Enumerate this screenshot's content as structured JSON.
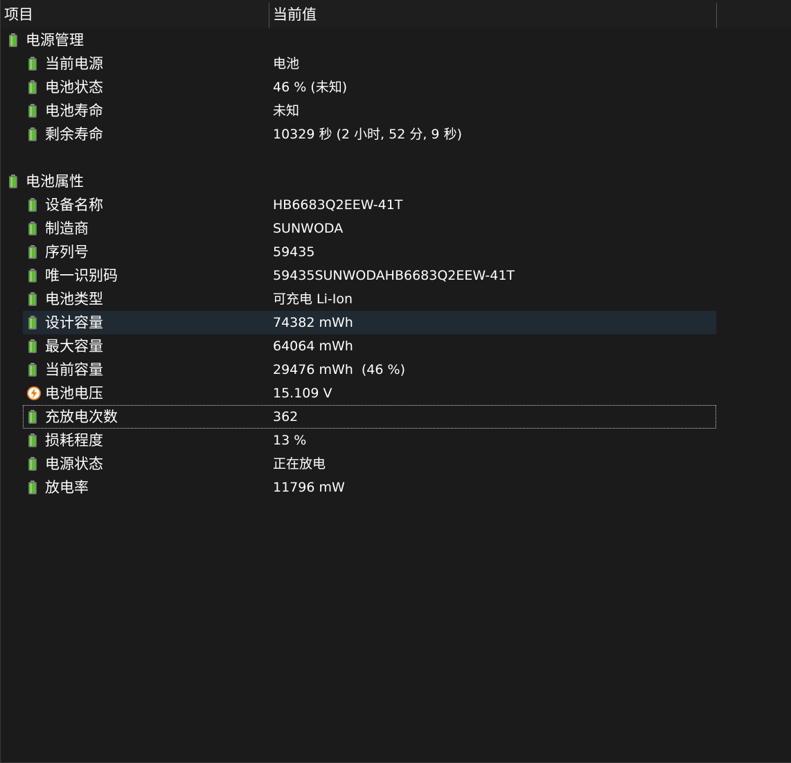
{
  "header": {
    "col_item": "项目",
    "col_value": "当前值"
  },
  "groups": [
    {
      "title": "电源管理",
      "icon": "battery-icon",
      "items": [
        {
          "label": "当前电源",
          "value": "电池",
          "icon": "battery-icon"
        },
        {
          "label": "电池状态",
          "value": "46 % (未知)",
          "icon": "battery-icon"
        },
        {
          "label": "电池寿命",
          "value": "未知",
          "icon": "battery-icon"
        },
        {
          "label": "剩余寿命",
          "value": "10329 秒 (2 小时, 52 分, 9 秒)",
          "icon": "battery-icon"
        }
      ]
    },
    {
      "title": "电池属性",
      "icon": "battery-icon",
      "items": [
        {
          "label": "设备名称",
          "value": "HB6683Q2EEW-41T",
          "icon": "battery-icon"
        },
        {
          "label": "制造商",
          "value": "SUNWODA",
          "icon": "battery-icon"
        },
        {
          "label": "序列号",
          "value": "59435",
          "icon": "battery-icon"
        },
        {
          "label": "唯一识别码",
          "value": "59435SUNWODAHB6683Q2EEW-41T",
          "icon": "battery-icon"
        },
        {
          "label": "电池类型",
          "value": "可充电 Li-Ion",
          "icon": "battery-icon"
        },
        {
          "label": "设计容量",
          "value": "74382 mWh",
          "icon": "battery-icon"
        },
        {
          "label": "最大容量",
          "value": "64064 mWh",
          "icon": "battery-icon"
        },
        {
          "label": "当前容量",
          "value": "29476 mWh  (46 %)",
          "icon": "battery-icon"
        },
        {
          "label": "电池电压",
          "value": "15.109 V",
          "icon": "voltage-icon"
        },
        {
          "label": "充放电次数",
          "value": "362",
          "icon": "battery-icon"
        },
        {
          "label": "损耗程度",
          "value": "13 %",
          "icon": "battery-icon"
        },
        {
          "label": "电源状态",
          "value": "正在放电",
          "icon": "battery-icon"
        },
        {
          "label": "放电率",
          "value": "11796 mW",
          "icon": "battery-icon"
        }
      ]
    }
  ],
  "colors": {
    "background": "#1b1b1b",
    "header_background": "#1e1e1e",
    "hover_row": "#1f2a33",
    "battery_green": "#5fb83a",
    "voltage_orange": "#e8801c"
  }
}
